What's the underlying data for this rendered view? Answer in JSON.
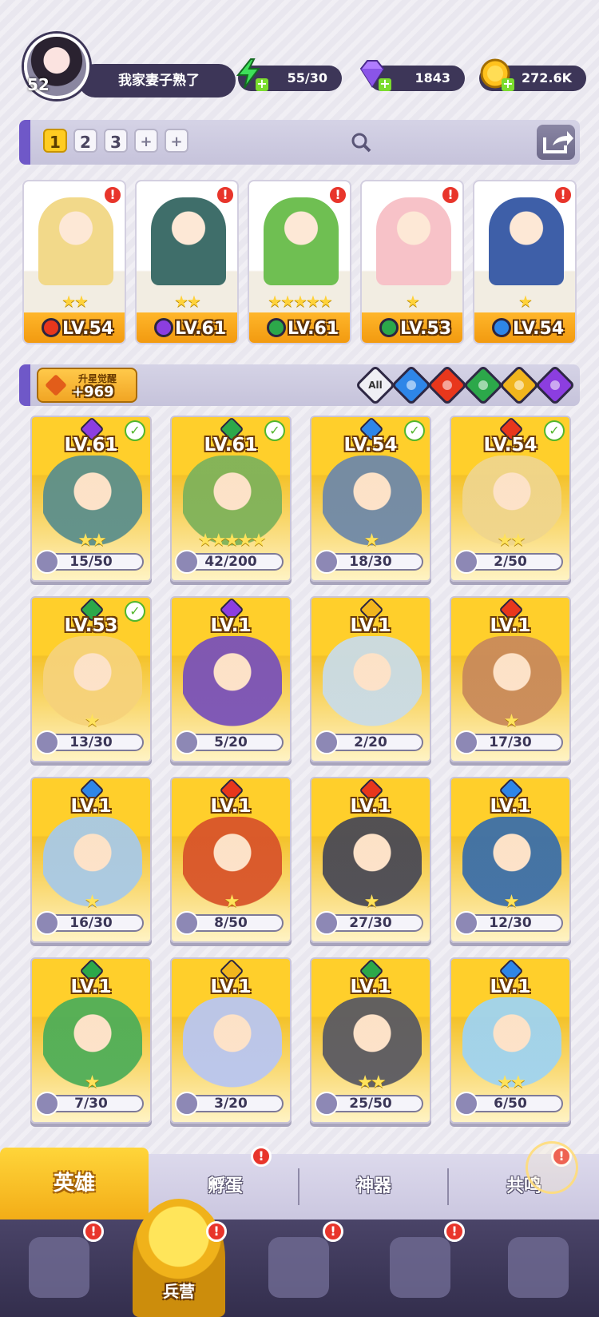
{
  "player": {
    "level": "52",
    "name": "我家妻子熟了"
  },
  "resources": [
    {
      "key": "energy",
      "icon": "lightning-icon",
      "value": "55/30",
      "color": "#3ee05a"
    },
    {
      "key": "gems",
      "icon": "diamond-icon",
      "value": "1843",
      "color": "#b07cff"
    },
    {
      "key": "gold",
      "icon": "coin-icon",
      "value": "272.6K",
      "color": "#ffc21d"
    }
  ],
  "team_slots": [
    "1",
    "2",
    "3",
    "+",
    "+"
  ],
  "team": [
    {
      "level": "LV.54",
      "stars": "★★",
      "element": "fire",
      "elem_color": "#e8371c",
      "art": "#f2d98a",
      "alert": "!"
    },
    {
      "level": "LV.61",
      "stars": "★★",
      "element": "dark",
      "elem_color": "#8c3ee0",
      "art": "#3f6e6a",
      "alert": "!"
    },
    {
      "level": "LV.61",
      "stars": "★★★★★",
      "element": "wind",
      "elem_color": "#2ca84a",
      "art": "#6fbf52",
      "alert": "!"
    },
    {
      "level": "LV.53",
      "stars": "★",
      "element": "wind",
      "elem_color": "#2ca84a",
      "art": "#f7c2c8",
      "alert": "!"
    },
    {
      "level": "LV.54",
      "stars": "★",
      "element": "water",
      "elem_color": "#2e86e8",
      "art": "#3e5fa8",
      "alert": "!"
    }
  ],
  "awaken": {
    "title": "升星觉醒",
    "value": "+969"
  },
  "filters": [
    {
      "key": "all",
      "label": "All",
      "color": "#efeff4"
    },
    {
      "key": "water",
      "icon": "water-drop-icon",
      "color": "#2e86e8"
    },
    {
      "key": "fire",
      "icon": "fire-icon",
      "color": "#e8371c"
    },
    {
      "key": "wind",
      "icon": "wind-icon",
      "color": "#2ca84a"
    },
    {
      "key": "light",
      "icon": "light-icon",
      "color": "#f1b51d"
    },
    {
      "key": "dark",
      "icon": "moon-icon",
      "color": "#8c3ee0"
    }
  ],
  "heroes": [
    {
      "level": "LV.61",
      "elem_color": "#8c3ee0",
      "checked": true,
      "stars": "★★",
      "shards": "15/50",
      "art": "#5c8f8b"
    },
    {
      "level": "LV.61",
      "elem_color": "#2ca84a",
      "checked": true,
      "stars": "★★★★★",
      "shards": "42/200",
      "art": "#7fb25a"
    },
    {
      "level": "LV.54",
      "elem_color": "#2e86e8",
      "checked": true,
      "stars": "★",
      "shards": "18/30",
      "art": "#6f89a8"
    },
    {
      "level": "LV.54",
      "elem_color": "#e8371c",
      "checked": true,
      "stars": "★★",
      "shards": "2/50",
      "art": "#efd58c"
    },
    {
      "level": "LV.53",
      "elem_color": "#2ca84a",
      "checked": true,
      "stars": "★",
      "shards": "13/30",
      "art": "#f6d27a"
    },
    {
      "level": "LV.1",
      "elem_color": "#8c3ee0",
      "checked": false,
      "stars": "",
      "shards": "5/20",
      "art": "#7a52b8"
    },
    {
      "level": "LV.1",
      "elem_color": "#f1b51d",
      "checked": false,
      "stars": "",
      "shards": "2/20",
      "art": "#c9dbe6"
    },
    {
      "level": "LV.1",
      "elem_color": "#e8371c",
      "checked": false,
      "stars": "★",
      "shards": "17/30",
      "art": "#c98a5a"
    },
    {
      "level": "LV.1",
      "elem_color": "#2e86e8",
      "checked": false,
      "stars": "★",
      "shards": "16/30",
      "art": "#a8c9e6"
    },
    {
      "level": "LV.1",
      "elem_color": "#e8371c",
      "checked": false,
      "stars": "★",
      "shards": "8/50",
      "art": "#d8552a"
    },
    {
      "level": "LV.1",
      "elem_color": "#e8371c",
      "checked": false,
      "stars": "★",
      "shards": "27/30",
      "art": "#4a4a55"
    },
    {
      "level": "LV.1",
      "elem_color": "#2e86e8",
      "checked": false,
      "stars": "★",
      "shards": "12/30",
      "art": "#3c6fa8"
    },
    {
      "level": "LV.1",
      "elem_color": "#2ca84a",
      "checked": false,
      "stars": "★",
      "shards": "7/30",
      "art": "#4fae58"
    },
    {
      "level": "LV.1",
      "elem_color": "#f1b51d",
      "checked": false,
      "stars": "",
      "shards": "3/20",
      "art": "#b9c6f0"
    },
    {
      "level": "LV.1",
      "elem_color": "#2ca84a",
      "checked": false,
      "stars": "★★",
      "shards": "25/50",
      "art": "#5a5a62"
    },
    {
      "level": "LV.1",
      "elem_color": "#2e86e8",
      "checked": false,
      "stars": "★★",
      "shards": "6/50",
      "art": "#9fd3f0"
    }
  ],
  "subtabs": [
    {
      "label": "英雄",
      "active": true,
      "alert": ""
    },
    {
      "label": "孵蛋",
      "active": false,
      "alert": "!"
    },
    {
      "label": "神器",
      "active": false,
      "alert": ""
    },
    {
      "label": "共鸣",
      "active": false,
      "alert": "!"
    }
  ],
  "nav": [
    {
      "icon": "cards-icon",
      "alert": "!"
    },
    {
      "icon": "barracks-icon",
      "label": "兵营",
      "active": true,
      "alert": "!"
    },
    {
      "icon": "map-icon",
      "alert": "!"
    },
    {
      "icon": "shop-icon",
      "alert": "!"
    },
    {
      "icon": "summon-icon",
      "alert": ""
    }
  ]
}
